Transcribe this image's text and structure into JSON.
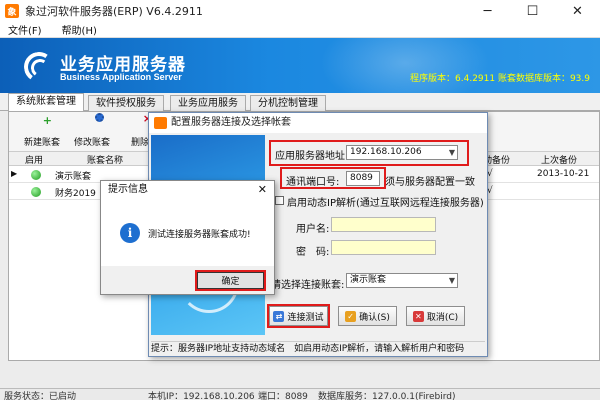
{
  "main_window": {
    "title": "象过河软件服务器(ERP) V6.4.2911",
    "app_icon_glyph": "象",
    "minimize_glyph": "─",
    "maximize_glyph": "☐",
    "close_glyph": "✕"
  },
  "menu": [
    "文件(F)",
    "帮助(H)"
  ],
  "banner": {
    "title": "业务应用服务器",
    "subtitle": "Business Application Server",
    "version_info": "程序版本：6.4.2911   账套数据库版本：93.9"
  },
  "tabs": [
    "系统账套管理",
    "软件授权服务",
    "业务应用服务",
    "分机控制管理"
  ],
  "toolbar": {
    "new_label": "新建账套",
    "edit_label": "修改账套",
    "delete_label": "删除"
  },
  "grid": {
    "headers": {
      "enabled": "启用",
      "name": "账套名称",
      "backup": "动备份",
      "last_backup": "上次备份"
    },
    "rows": [
      {
        "marker": "▶",
        "name": "演示账套",
        "backup": "√",
        "last_backup": "2013-10-21"
      },
      {
        "marker": "",
        "name": "财务2019",
        "backup": "√",
        "last_backup": ""
      }
    ]
  },
  "config_dialog": {
    "title": "配置服务器连接及选择帐套",
    "server_address_label": "应用服务器地址:",
    "server_address_value": "192.168.10.206",
    "port_label": "通讯端口号:",
    "port_value": "8089",
    "port_note": "须与服务器配置一致",
    "dynamic_ip_label": "启用动态IP解析(通过互联网远程连接服务器)",
    "username_label": "用户名:",
    "password_label": "密　码:",
    "account_select_label": "请选择连接账套:",
    "account_select_value": "演示账套",
    "test_button": "连接测试",
    "ok_button": "确认(S)",
    "cancel_button": "取消(C)",
    "hint": "提示：服务器IP地址支持动态域名　如启用动态IP解析，请输入解析用户和密码"
  },
  "message_box": {
    "title": "提示信息",
    "close_glyph": "✕",
    "info_glyph": "i",
    "text": "测试连接服务器账套成功!",
    "ok_button": "确定"
  },
  "status_bar": {
    "service_status": "服务状态：已启动",
    "local_ip": "本机IP：192.168.10.206",
    "port": "端口：8089",
    "db_server": "数据库服务：127.0.0.1(Firebird)"
  }
}
